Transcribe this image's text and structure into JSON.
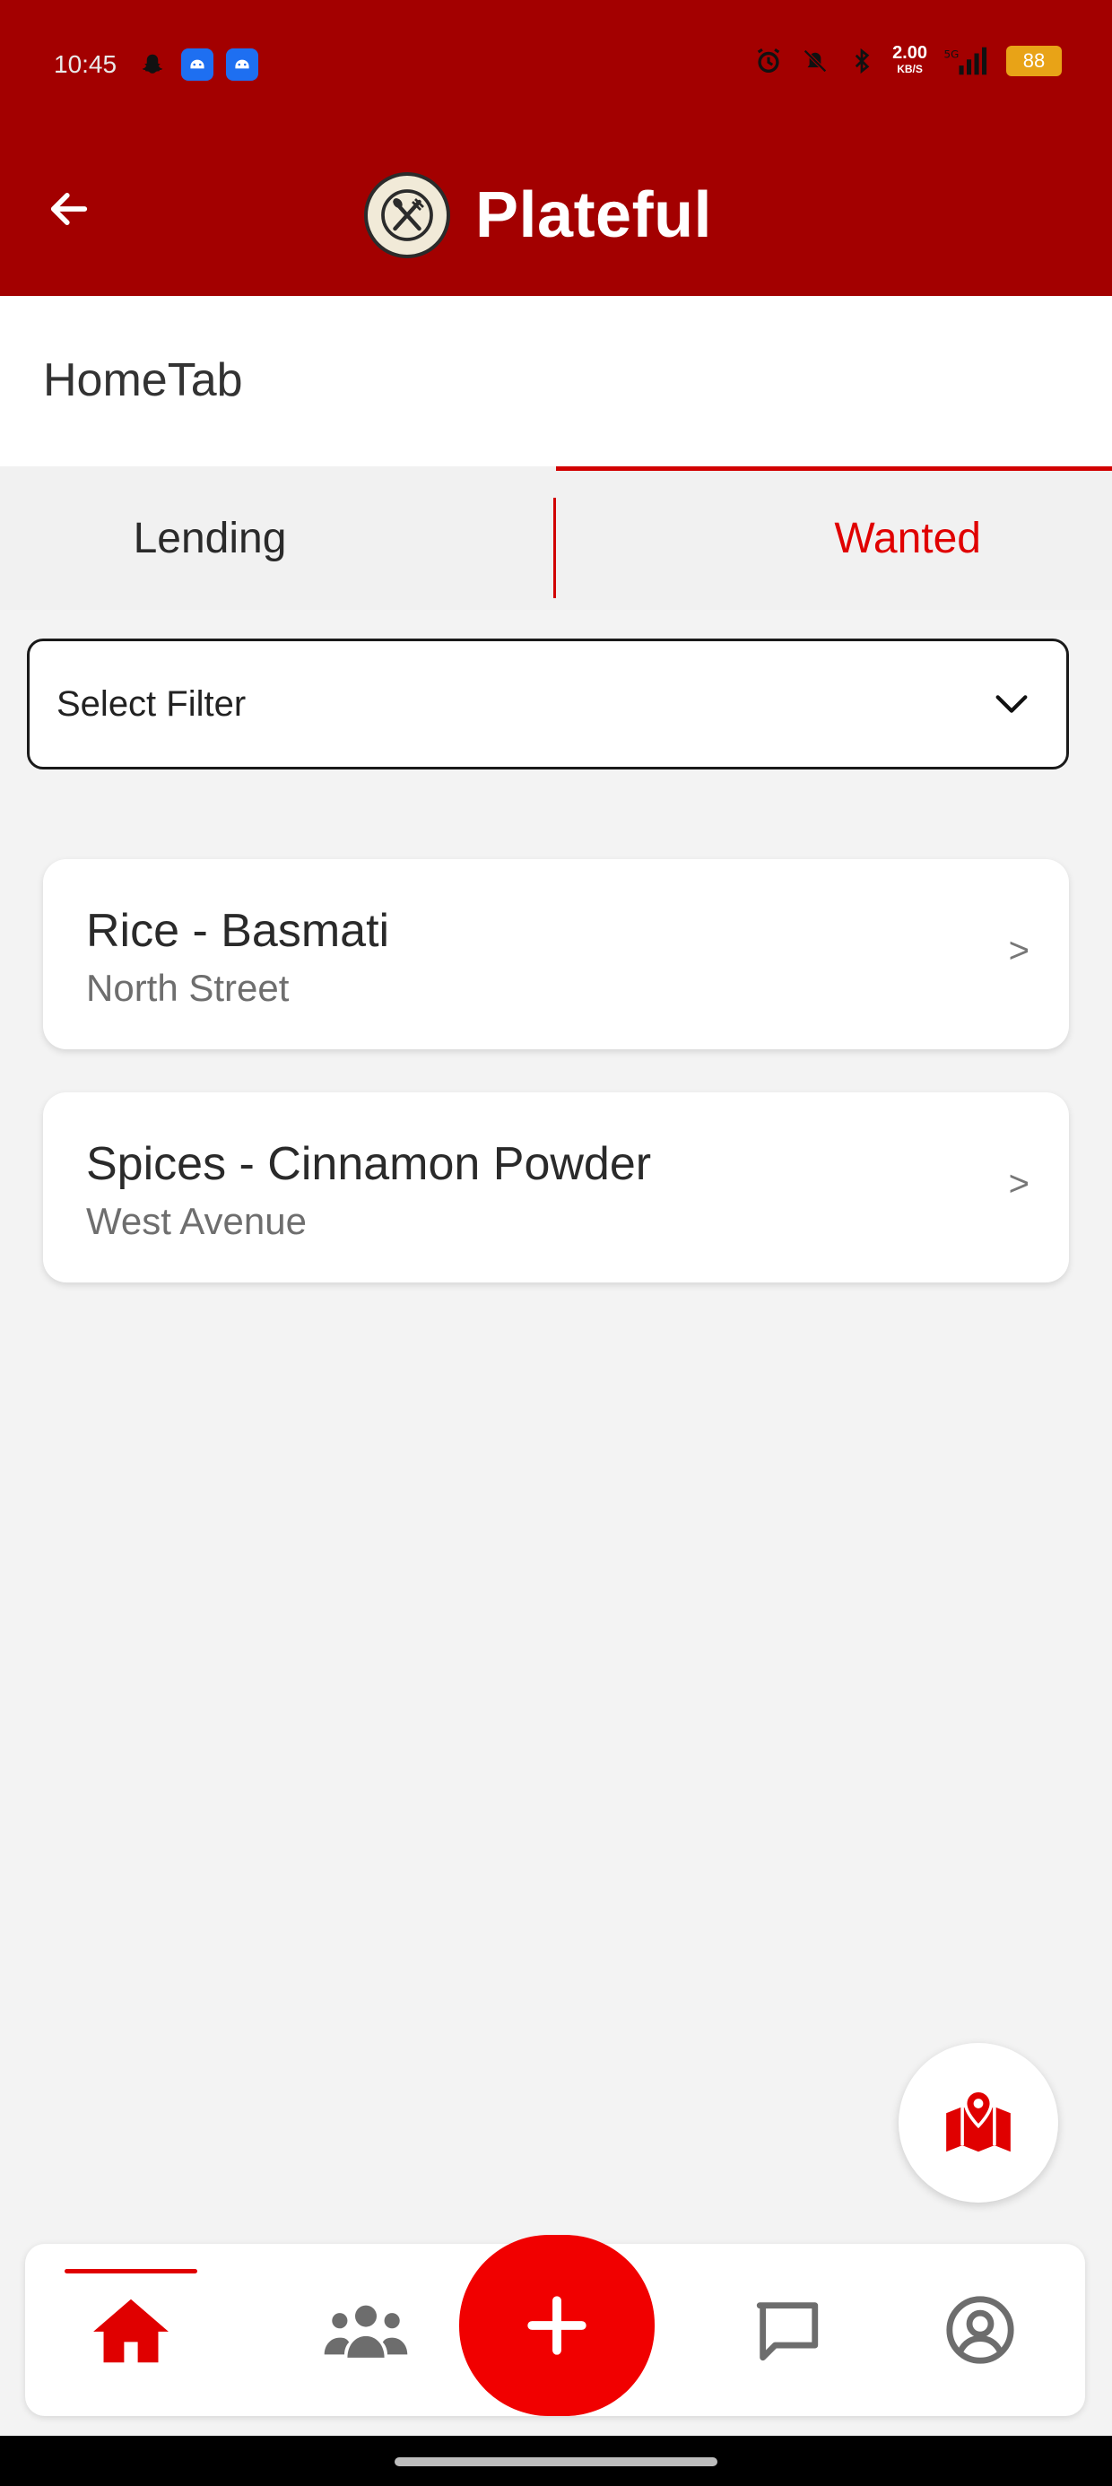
{
  "status_bar": {
    "time": "10:45",
    "net_speed": "2.00",
    "net_unit": "KB/S",
    "battery": "88"
  },
  "app_bar": {
    "title": "Plateful"
  },
  "page": {
    "title": "HomeTab"
  },
  "tabs": [
    {
      "label": "Lending",
      "active": false
    },
    {
      "label": "Wanted",
      "active": true
    }
  ],
  "filter": {
    "label": "Select Filter"
  },
  "items": [
    {
      "title": "Rice - Basmati",
      "location": "North Street",
      "chevron": ">"
    },
    {
      "title": "Spices - Cinnamon Powder",
      "location": "West Avenue",
      "chevron": ">"
    }
  ],
  "colors": {
    "header": "#a30000",
    "accent": "#e00000",
    "fab": "#f10000",
    "background": "#f3f3f3"
  },
  "icons": {
    "back": "arrow-left-icon",
    "logo": "plate-fork-spoon-logo",
    "filter_chevron": "chevron-down-icon",
    "map": "map-pin-icon",
    "home": "home-icon",
    "people": "people-icon",
    "add": "plus-icon",
    "chat": "chat-bubble-icon",
    "profile": "user-circle-icon"
  }
}
